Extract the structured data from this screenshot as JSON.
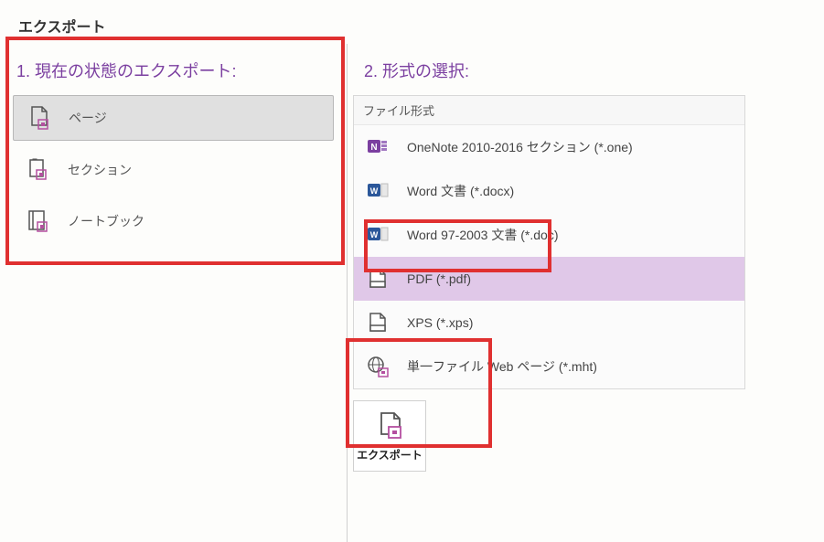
{
  "title": "エクスポート",
  "step1": {
    "heading": "1. 現在の状態のエクスポート:",
    "items": [
      {
        "label": "ページ",
        "selected": true
      },
      {
        "label": "セクション",
        "selected": false
      },
      {
        "label": "ノートブック",
        "selected": false
      }
    ]
  },
  "step2": {
    "heading": "2. 形式の選択:",
    "panel_header": "ファイル形式",
    "formats": [
      {
        "label": "OneNote 2010-2016 セクション (*.one)",
        "icon": "onenote-icon",
        "selected": false
      },
      {
        "label": "Word 文書 (*.docx)",
        "icon": "word-icon",
        "selected": false
      },
      {
        "label": "Word 97-2003 文書 (*.doc)",
        "icon": "word-icon",
        "selected": false
      },
      {
        "label": "PDF (*.pdf)",
        "icon": "pdf-icon",
        "selected": true
      },
      {
        "label": "XPS (*.xps)",
        "icon": "xps-icon",
        "selected": false
      },
      {
        "label": "単一ファイル Web ページ (*.mht)",
        "icon": "web-icon",
        "selected": false
      }
    ]
  },
  "export_button": {
    "label": "エクスポート"
  }
}
